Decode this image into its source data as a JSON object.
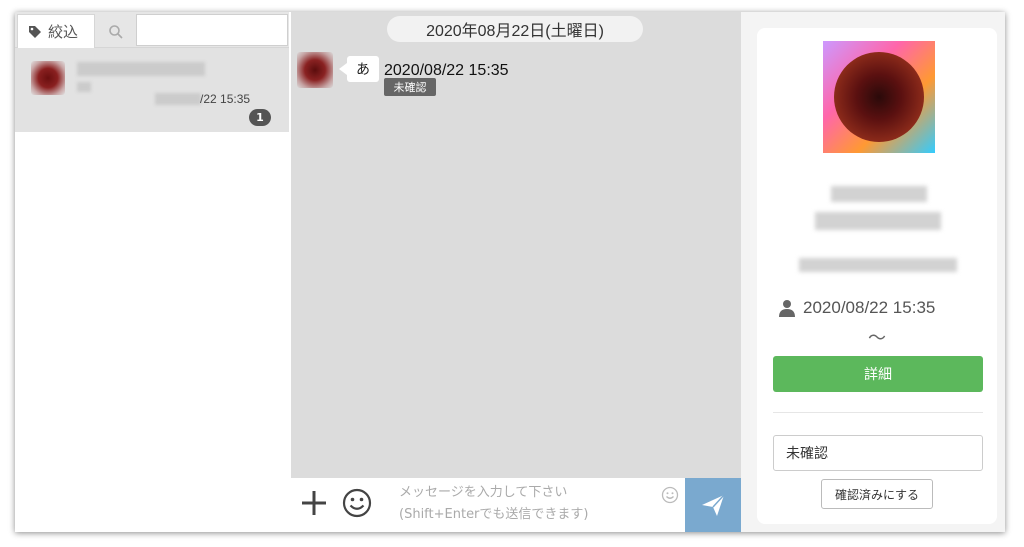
{
  "sidebar": {
    "filter_label": "絞込",
    "search_placeholder": "",
    "conversations": [
      {
        "time": "/22 15:35",
        "unread_count": "1"
      }
    ]
  },
  "chat": {
    "date_divider": "2020年08月22日(土曜日)",
    "messages": [
      {
        "text": "あ",
        "timestamp": "2020/08/22 15:35",
        "status": "未確認"
      }
    ],
    "composer": {
      "placeholder": "メッセージを入力して下さい\n(Shift+Enterでも送信できます)"
    }
  },
  "profile": {
    "period_start": "2020/08/22 15:35",
    "period_separator": "〜",
    "detail_button": "詳細",
    "status_value": "未確認",
    "confirm_button": "確認済みにする"
  },
  "colors": {
    "send_button": "#7aa9cf",
    "detail_button": "#5cb85c",
    "chat_bg": "#dcdcdc"
  }
}
